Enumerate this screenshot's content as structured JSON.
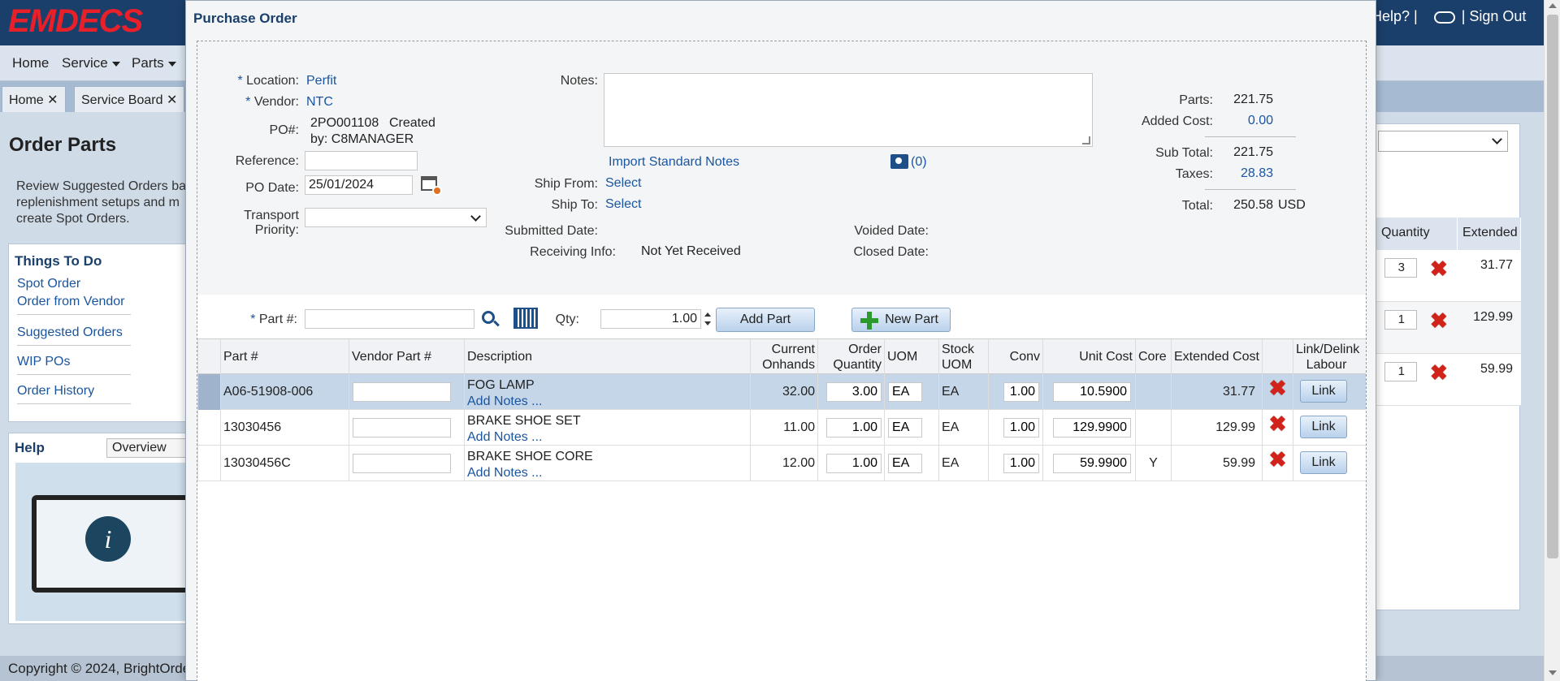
{
  "app": {
    "logo": "EMDECS",
    "top_links": {
      "help": "Help? |",
      "sign_out": "| Sign Out"
    },
    "nav": [
      "Home",
      "Service",
      "Parts"
    ],
    "tabs": [
      {
        "label": "Home"
      },
      {
        "label": "Service Board"
      }
    ]
  },
  "background": {
    "title": "Order Parts",
    "description": "Review Suggested Orders ba replenishment setups and m create Spot Orders.",
    "things_to_do": {
      "heading": "Things To Do",
      "items": [
        "Spot Order",
        "Order from Vendor",
        "Suggested Orders",
        "WIP POs",
        "Order History"
      ]
    },
    "help": {
      "heading": "Help",
      "overview": "Overview"
    },
    "footer": "Copyright © 2024, BrightOrde",
    "right_panel": {
      "col_quantity": "Quantity",
      "col_extended": "Extended",
      "rows": [
        {
          "qty": "3",
          "ext": "31.77"
        },
        {
          "qty": "1",
          "ext": "129.99"
        },
        {
          "qty": "1",
          "ext": "59.99"
        }
      ]
    }
  },
  "modal": {
    "title": "Purchase Order",
    "location_label": "Location:",
    "location_value": "Perfit",
    "vendor_label": "Vendor:",
    "vendor_value": "NTC",
    "po_label": "PO#:",
    "po_number": "2PO001108",
    "created_by_line1": "Created",
    "created_by_line2": "by:  C8MANAGER",
    "reference_label": "Reference:",
    "reference_value": "",
    "po_date_label": "PO Date:",
    "po_date_value": "25/01/2024",
    "transport_label_1": "Transport",
    "transport_label_2": "Priority:",
    "transport_value": "",
    "notes_label": "Notes:",
    "notes_value": "",
    "import_notes": "Import Standard Notes",
    "attach_count": "(0)",
    "ship_from_label": "Ship From:",
    "ship_from_value": "Select",
    "ship_to_label": "Ship To:",
    "ship_to_value": "Select",
    "submitted_label": "Submitted Date:",
    "receiving_label": "Receiving Info:",
    "receiving_value": "Not Yet Received",
    "voided_label": "Voided Date:",
    "closed_label": "Closed Date:",
    "totals": {
      "parts_label": "Parts:",
      "parts": "221.75",
      "added_label": "Added Cost:",
      "added": "0.00",
      "subtotal_label": "Sub Total:",
      "subtotal": "221.75",
      "taxes_label": "Taxes:",
      "taxes": "28.83",
      "total_label": "Total:",
      "total": "250.58",
      "currency": "USD"
    },
    "part_entry": {
      "part_label": "Part #:",
      "part_value": "",
      "qty_label": "Qty:",
      "qty_value": "1.00",
      "add_part": "Add Part",
      "new_part": "New Part"
    },
    "table": {
      "headers": {
        "part": "Part #",
        "vendor_part": "Vendor Part #",
        "description": "Description",
        "current_onhands_1": "Current",
        "current_onhands_2": "Onhands",
        "order_qty_1": "Order",
        "order_qty_2": "Quantity",
        "uom": "UOM",
        "stock_uom_1": "Stock",
        "stock_uom_2": "UOM",
        "conv": "Conv",
        "unit_cost": "Unit Cost",
        "core": "Core",
        "extended_cost": "Extended Cost",
        "link_1": "Link/Delink",
        "link_2": "Labour"
      },
      "rows": [
        {
          "part": "A06-51908-006",
          "vendor_part": "",
          "desc": "FOG LAMP",
          "add_notes": "Add Notes ...",
          "onhands": "32.00",
          "order_qty": "3.00",
          "uom": "EA",
          "stock_uom": "EA",
          "conv": "1.00",
          "unit_cost": "10.5900",
          "core": "",
          "extended": "31.77",
          "link": "Link"
        },
        {
          "part": "13030456",
          "vendor_part": "",
          "desc": "BRAKE SHOE SET",
          "add_notes": "Add Notes ...",
          "onhands": "11.00",
          "order_qty": "1.00",
          "uom": "EA",
          "stock_uom": "EA",
          "conv": "1.00",
          "unit_cost": "129.9900",
          "core": "",
          "extended": "129.99",
          "link": "Link"
        },
        {
          "part": "13030456C",
          "vendor_part": "",
          "desc": "BRAKE SHOE CORE",
          "add_notes": "Add Notes ...",
          "onhands": "12.00",
          "order_qty": "1.00",
          "uom": "EA",
          "stock_uom": "EA",
          "conv": "1.00",
          "unit_cost": "59.9900",
          "core": "Y",
          "extended": "59.99",
          "link": "Link"
        }
      ]
    }
  },
  "colors": {
    "accent": "#1a55a0",
    "header_bg": "#1b3f6b",
    "logo": "#e8202a",
    "delete": "#d2231a",
    "selected_row": "#c5d6e8"
  }
}
